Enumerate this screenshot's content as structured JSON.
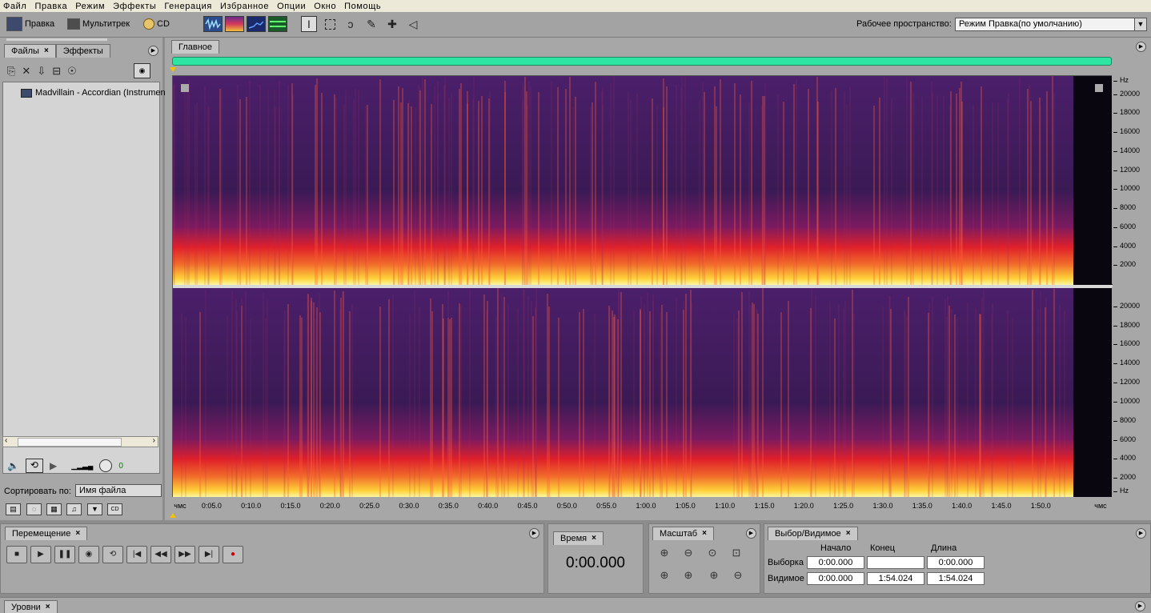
{
  "menu": [
    "Файл",
    "Правка",
    "Режим",
    "Эффекты",
    "Генерация",
    "Избранное",
    "Опции",
    "Окно",
    "Помощь"
  ],
  "toolbar": {
    "modes": [
      {
        "label": "Правка",
        "icon": "waveform-edit-icon"
      },
      {
        "label": "Мультитрек",
        "icon": "multitrack-icon"
      },
      {
        "label": "CD",
        "icon": "cd-icon"
      }
    ],
    "workspace_label": "Рабочее пространство:",
    "workspace_value": "Режим Правка(по умолчанию)"
  },
  "left_panel": {
    "tabs": [
      "Файлы",
      "Эффекты"
    ],
    "files": [
      "Madvillain - Accordian (Instrumen"
    ],
    "volume_value": "0",
    "sort_label": "Сортировать по:",
    "sort_value": "Имя файла"
  },
  "main_panel": {
    "tab": "Главное",
    "hz_unit": "Hz",
    "hz_ticks": [
      "20000",
      "18000",
      "16000",
      "14000",
      "12000",
      "10000",
      "8000",
      "6000",
      "4000",
      "2000"
    ],
    "time_ticks": [
      "чмс",
      "0:05.0",
      "0:10.0",
      "0:15.0",
      "0:20.0",
      "0:25.0",
      "0:30.0",
      "0:35.0",
      "0:40.0",
      "0:45.0",
      "0:50.0",
      "0:55.0",
      "1:00.0",
      "1:05.0",
      "1:10.0",
      "1:15.0",
      "1:20.0",
      "1:25.0",
      "1:30.0",
      "1:35.0",
      "1:40.0",
      "1:45.0",
      "1:50.0",
      "чмс"
    ]
  },
  "transport": {
    "tab": "Перемещение"
  },
  "time": {
    "tab": "Время",
    "value": "0:00.000"
  },
  "zoom": {
    "tab": "Масштаб"
  },
  "selection": {
    "tab": "Выбор/Видимое",
    "headers": [
      "Начало",
      "Конец",
      "Длина"
    ],
    "rows": [
      {
        "label": "Выборка",
        "begin": "0:00.000",
        "end": "",
        "length": "0:00.000"
      },
      {
        "label": "Видимое",
        "begin": "0:00.000",
        "end": "1:54.024",
        "length": "1:54.024"
      }
    ]
  },
  "levels": {
    "tab": "Уровни"
  },
  "colors": {
    "timeline": "#2ee5a3",
    "panel": "#a7a7a7",
    "spectrogram_low": "#ffd23a",
    "spectrogram_mid": "#e0202a",
    "spectrogram_high": "#4b1f6a"
  }
}
